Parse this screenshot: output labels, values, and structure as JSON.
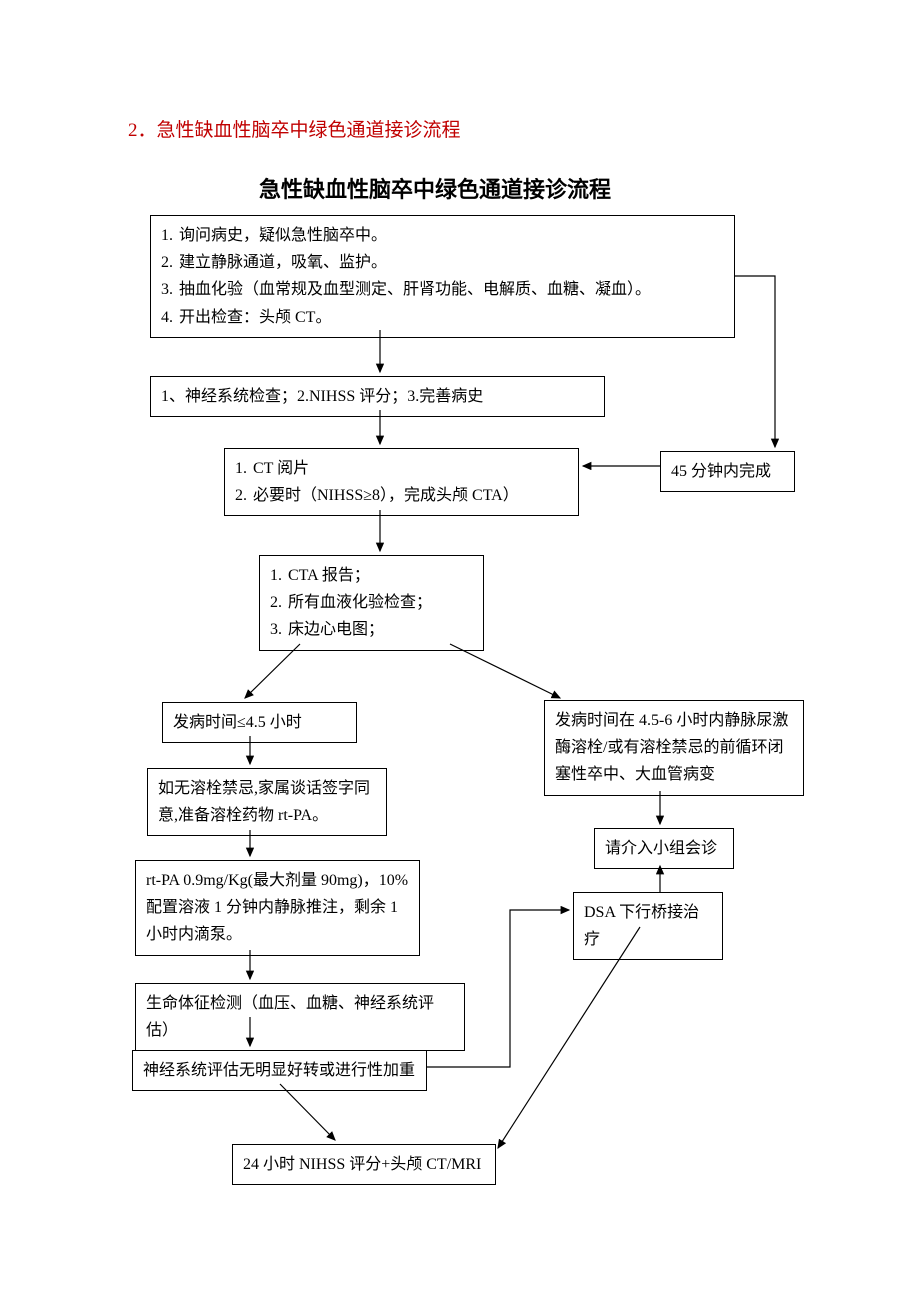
{
  "section_heading": "2．急性缺血性脑卒中绿色通道接诊流程",
  "main_title": "急性缺血性脑卒中绿色通道接诊流程",
  "box1": {
    "item1_num": "1.",
    "item1": "询问病史，疑似急性脑卒中。",
    "item2_num": "2.",
    "item2": "建立静脉通道，吸氧、监护。",
    "item3_num": "3.",
    "item3": "抽血化验（血常规及血型测定、肝肾功能、电解质、血糖、凝血）。",
    "item4_num": "4.",
    "item4": "开出检查：头颅 CT。"
  },
  "box2": "1、神经系统检查；2.NIHSS 评分；3.完善病史",
  "box_time": "45 分钟内完成",
  "box3": {
    "item1_num": "1.",
    "item1": "CT 阅片",
    "item2_num": "2.",
    "item2": "必要时（NIHSS≥8），完成头颅 CTA）"
  },
  "box4": {
    "item1_num": "1.",
    "item1": "CTA 报告；",
    "item2_num": "2.",
    "item2": "所有血液化验检查；",
    "item3_num": "3.",
    "item3": "床边心电图；"
  },
  "box5_left": "发病时间≤4.5 小时",
  "box5_right": "发病时间在 4.5-6 小时内静脉尿激酶溶栓/或有溶栓禁忌的前循环闭塞性卒中、大血管病变",
  "box6": "如无溶栓禁忌,家属谈话签字同意,准备溶栓药物 rt-PA。",
  "box7": "rt-PA 0.9mg/Kg(最大剂量 90mg)，10%配置溶液 1 分钟内静脉推注，剩余 1小时内滴泵。",
  "box8": "生命体征检测（血压、血糖、神经系统评估）",
  "box9": "神经系统评估无明显好转或进行性加重",
  "box10_right_top": "请介入小组会诊",
  "box10_right_bottom": "DSA 下行桥接治疗",
  "box_final": "24 小时 NIHSS 评分+头颅 CT/MRI"
}
